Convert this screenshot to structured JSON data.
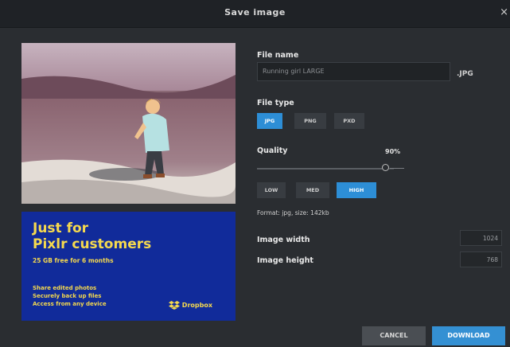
{
  "dialog": {
    "title": "Save image",
    "close_glyph": "×"
  },
  "preview": {
    "description_icon": "photo-preview"
  },
  "ad": {
    "headline_line1": "Just for",
    "headline_line2": "Pixlr customers",
    "subline": "25 GB free for 6 months",
    "bullets": [
      "Share edited photos",
      "Securely back up files",
      "Access from any device"
    ],
    "brand": "Dropbox",
    "brand_color": "#f5d94e",
    "bg_color": "#112b9a"
  },
  "form": {
    "file_name_label": "File name",
    "file_name_value": "Running girl LARGE",
    "extension": ".JPG",
    "file_type_label": "File type",
    "file_types": [
      "JPG",
      "PNG",
      "PXD"
    ],
    "file_type_selected": "JPG",
    "quality_label": "Quality",
    "quality_value": "90%",
    "quality_level": 0.9,
    "quality_presets": [
      "LOW",
      "MED",
      "HIGH"
    ],
    "quality_preset_selected": "HIGH",
    "format_info": "Format: jpg, size: 142kb",
    "width_label": "Image width",
    "width_value": "1024",
    "height_label": "Image height",
    "height_value": "768"
  },
  "actions": {
    "cancel_label": "CANCEL",
    "download_label": "DOWNLOAD",
    "accent": "#3490d3"
  }
}
